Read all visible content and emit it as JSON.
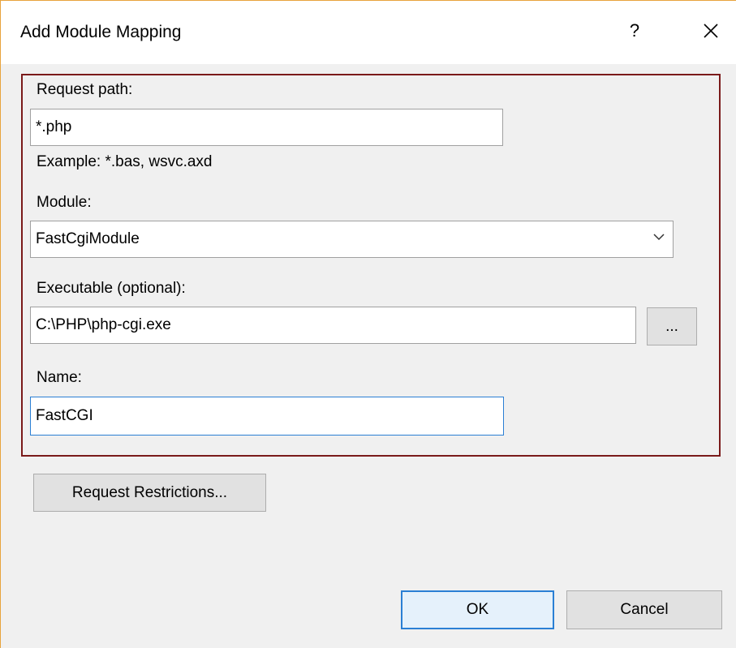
{
  "window": {
    "title": "Add Module Mapping",
    "help_label": "?",
    "close_icon": "close-icon"
  },
  "form": {
    "request_path_label": "Request path:",
    "request_path_value": "*.php",
    "example_text": "Example: *.bas, wsvc.axd",
    "module_label": "Module:",
    "module_value": "FastCgiModule",
    "executable_label": "Executable (optional):",
    "executable_value": "C:\\PHP\\php-cgi.exe",
    "browse_label": "...",
    "name_label": "Name:",
    "name_value": "FastCGI"
  },
  "buttons": {
    "request_restrictions": "Request Restrictions...",
    "ok": "OK",
    "cancel": "Cancel"
  },
  "colors": {
    "group_border": "#7a1a1a",
    "focus_border": "#2a7fd4",
    "window_edge": "#e8a33d"
  }
}
